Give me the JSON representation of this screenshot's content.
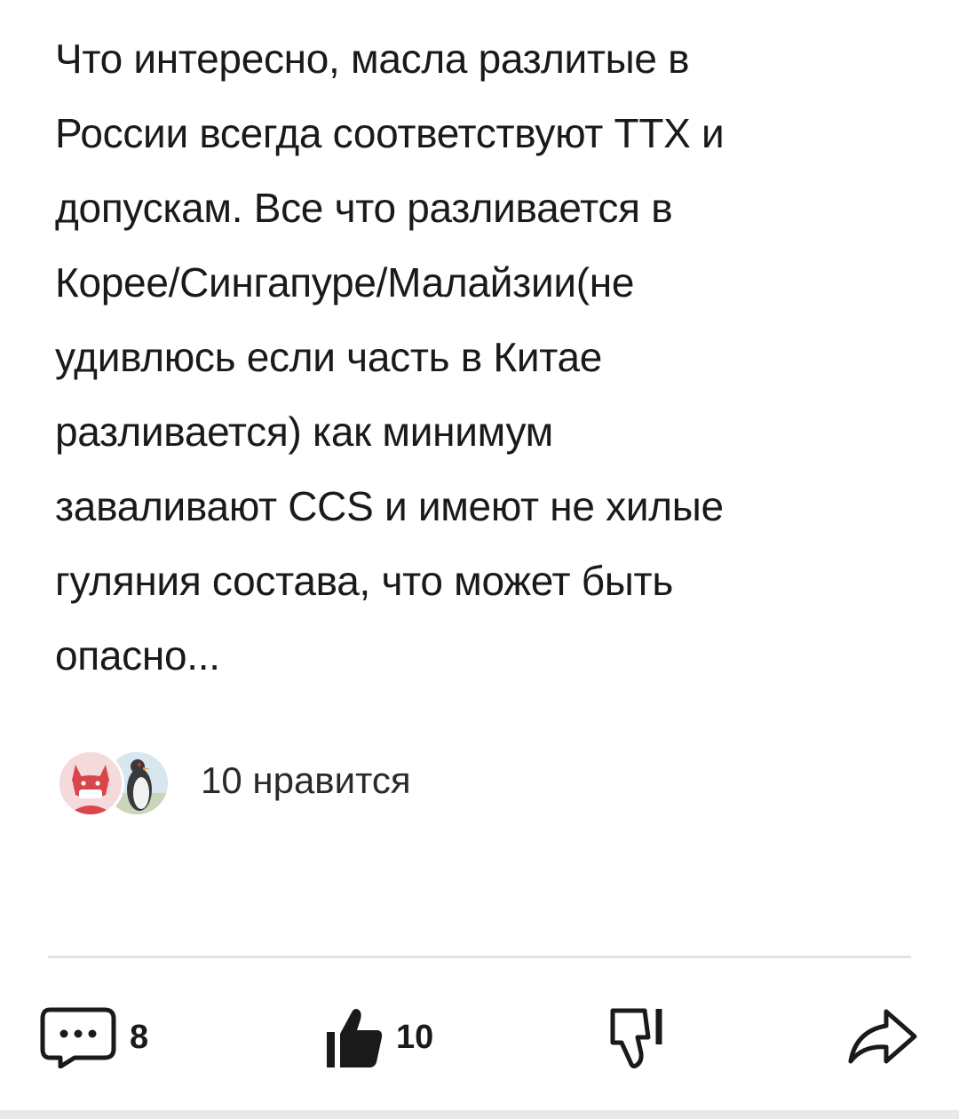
{
  "comment": {
    "lines": [
      "Что интересно, масла разлитые в",
      "России всегда соответствуют ТТХ и",
      "допускам. Все что разливается в",
      "Корее/Сингапуре/Малайзии(не",
      "удивлюсь если часть в Китае",
      "разливается) как минимум",
      "заваливают CCS и имеют не хилые",
      "гуляния состава, что может быть",
      "опасно..."
    ]
  },
  "likes": {
    "summary": "10 нравится"
  },
  "toolbar": {
    "comments_count": "8",
    "likes_count": "10"
  },
  "colors": {
    "text": "#1a1a1a",
    "icon": "#1a1a1a",
    "divider": "#e3e3e3",
    "avatar_fox": "#d9454a"
  },
  "icons": {
    "comments": "speech-bubble-ellipsis-icon",
    "like": "thumbs-up-icon",
    "dislike": "thumbs-down-icon",
    "share": "share-arrow-icon"
  }
}
